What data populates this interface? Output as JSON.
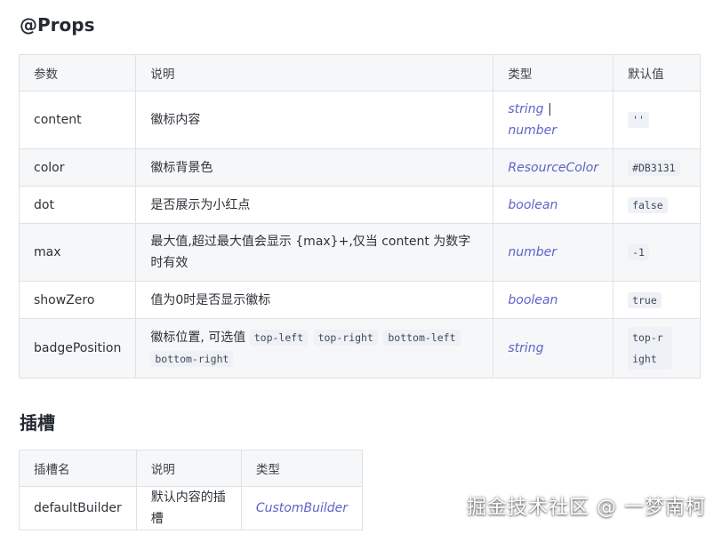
{
  "props_section": {
    "title": "@Props",
    "headers": [
      "参数",
      "说明",
      "类型",
      "默认值"
    ],
    "rows": [
      {
        "param": "content",
        "desc": "徽标内容",
        "type": "string",
        "type_sep": " | ",
        "type2": "number",
        "default": "''"
      },
      {
        "param": "color",
        "desc": "徽标背景色",
        "type": "ResourceColor",
        "default": "#DB3131"
      },
      {
        "param": "dot",
        "desc": "是否展示为小红点",
        "type": "boolean",
        "default": "false"
      },
      {
        "param": "max",
        "desc": "最大值,超过最大值会显示 {max}+,仅当 content 为数字时有效",
        "type": "number",
        "default": "-1"
      },
      {
        "param": "showZero",
        "desc": "值为0时是否显示徽标",
        "type": "boolean",
        "default": "true"
      },
      {
        "param": "badgePosition",
        "desc": "徽标位置, 可选值",
        "desc_codes": [
          "top-left",
          "top-right",
          "bottom-left",
          "bottom-right"
        ],
        "type": "string",
        "default": "top-right"
      }
    ]
  },
  "slots_section": {
    "title": "插槽",
    "headers": [
      "插槽名",
      "说明",
      "类型"
    ],
    "rows": [
      {
        "name": "defaultBuilder",
        "desc": "默认内容的插槽",
        "type": "CustomBuilder"
      }
    ]
  },
  "watermark": "掘金技术社区 @ 一梦南柯"
}
